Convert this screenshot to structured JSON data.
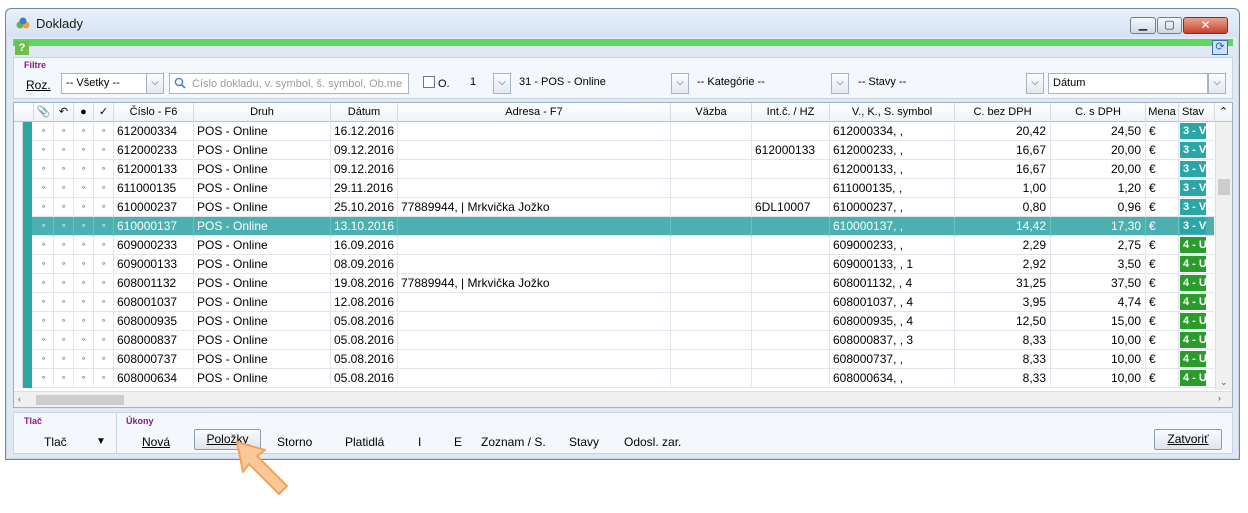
{
  "window": {
    "title": "Doklady",
    "help": "?"
  },
  "filters": {
    "section_label": "Filtre",
    "roz_label": "Roz.",
    "roz_value": "-- Všetky --",
    "search_placeholder": "Číslo dokladu, v. symbol, š. symbol, Ob.menc",
    "o_label": "O.",
    "number_value": "1",
    "type_value": "31 - POS - Online",
    "category_value": "-- Kategórie --",
    "states_value": "-- Stavy --",
    "sort_value": "Dátum"
  },
  "table": {
    "headers": [
      "Číslo - F6",
      "Druh",
      "Dátum",
      "Adresa - F7",
      "Väzba",
      "Int.č. / HZ",
      "V., K., S. symbol",
      "C. bez DPH",
      "C. s DPH",
      "Mena",
      "Stav"
    ],
    "rows": [
      {
        "cislo": "612000334",
        "druh": "POS - Online",
        "datum": "16.12.2016",
        "adresa": "",
        "vazba": "",
        "intc": "",
        "symbol": "612000334, ,",
        "bez": "20,42",
        "sdph": "24,50",
        "mena": "€",
        "stav": "3 - V",
        "stav_color": "#2aa6a6"
      },
      {
        "cislo": "612000233",
        "druh": "POS - Online",
        "datum": "09.12.2016",
        "adresa": "",
        "vazba": "",
        "intc": "612000133",
        "symbol": "612000233, ,",
        "bez": "16,67",
        "sdph": "20,00",
        "mena": "€",
        "stav": "3 - V",
        "stav_color": "#2aa6a6"
      },
      {
        "cislo": "612000133",
        "druh": "POS - Online",
        "datum": "09.12.2016",
        "adresa": "",
        "vazba": "",
        "intc": "",
        "symbol": "612000133, ,",
        "bez": "16,67",
        "sdph": "20,00",
        "mena": "€",
        "stav": "3 - V",
        "stav_color": "#2aa6a6"
      },
      {
        "cislo": "611000135",
        "druh": "POS - Online",
        "datum": "29.11.2016",
        "adresa": "",
        "vazba": "",
        "intc": "",
        "symbol": "611000135, ,",
        "bez": "1,00",
        "sdph": "1,20",
        "mena": "€",
        "stav": "3 - V",
        "stav_color": "#2aa6a6"
      },
      {
        "cislo": "610000237",
        "druh": "POS - Online",
        "datum": "25.10.2016",
        "adresa": "77889944,  | Mrkvička Jožko",
        "vazba": "",
        "intc": "6DL10007",
        "symbol": "610000237, ,",
        "bez": "0,80",
        "sdph": "0,96",
        "mena": "€",
        "stav": "3 - V",
        "stav_color": "#2aa6a6"
      },
      {
        "cislo": "610000137",
        "druh": "POS - Online",
        "datum": "13.10.2016",
        "adresa": "",
        "vazba": "",
        "intc": "",
        "symbol": "610000137, ,",
        "bez": "14,42",
        "sdph": "17,30",
        "mena": "€",
        "stav": "3 - V",
        "stav_color": "#2aa6a6",
        "selected": true
      },
      {
        "cislo": "609000233",
        "druh": "POS - Online",
        "datum": "16.09.2016",
        "adresa": "",
        "vazba": "",
        "intc": "",
        "symbol": "609000233, ,",
        "bez": "2,29",
        "sdph": "2,75",
        "mena": "€",
        "stav": "4 - U",
        "stav_color": "#2b9c2b"
      },
      {
        "cislo": "609000133",
        "druh": "POS - Online",
        "datum": "08.09.2016",
        "adresa": "",
        "vazba": "",
        "intc": "",
        "symbol": "609000133, , 1",
        "bez": "2,92",
        "sdph": "3,50",
        "mena": "€",
        "stav": "4 - U",
        "stav_color": "#2b9c2b"
      },
      {
        "cislo": "608001132",
        "druh": "POS - Online",
        "datum": "19.08.2016",
        "adresa": "77889944,  | Mrkvička Jožko",
        "vazba": "",
        "intc": "",
        "symbol": "608001132, , 4",
        "bez": "31,25",
        "sdph": "37,50",
        "mena": "€",
        "stav": "4 - U",
        "stav_color": "#2b9c2b"
      },
      {
        "cislo": "608001037",
        "druh": "POS - Online",
        "datum": "12.08.2016",
        "adresa": "",
        "vazba": "",
        "intc": "",
        "symbol": "608001037, , 4",
        "bez": "3,95",
        "sdph": "4,74",
        "mena": "€",
        "stav": "4 - U",
        "stav_color": "#2b9c2b"
      },
      {
        "cislo": "608000935",
        "druh": "POS - Online",
        "datum": "05.08.2016",
        "adresa": "",
        "vazba": "",
        "intc": "",
        "symbol": "608000935, , 4",
        "bez": "12,50",
        "sdph": "15,00",
        "mena": "€",
        "stav": "4 - U",
        "stav_color": "#2b9c2b"
      },
      {
        "cislo": "608000837",
        "druh": "POS - Online",
        "datum": "05.08.2016",
        "adresa": "",
        "vazba": "",
        "intc": "",
        "symbol": "608000837, , 3",
        "bez": "8,33",
        "sdph": "10,00",
        "mena": "€",
        "stav": "4 - U",
        "stav_color": "#2b9c2b"
      },
      {
        "cislo": "608000737",
        "druh": "POS - Online",
        "datum": "05.08.2016",
        "adresa": "",
        "vazba": "",
        "intc": "",
        "symbol": "608000737, ,",
        "bez": "8,33",
        "sdph": "10,00",
        "mena": "€",
        "stav": "4 - U",
        "stav_color": "#2b9c2b"
      },
      {
        "cislo": "608000634",
        "druh": "POS - Online",
        "datum": "05.08.2016",
        "adresa": "",
        "vazba": "",
        "intc": "",
        "symbol": "608000634, ,",
        "bez": "8,33",
        "sdph": "10,00",
        "mena": "€",
        "stav": "4 - U",
        "stav_color": "#2b9c2b"
      }
    ]
  },
  "bottom": {
    "tlac_label": "Tlač",
    "tlac_button": "Tlač",
    "ukony_label": "Úkony",
    "actions": {
      "nova": "Nová",
      "polozky": "Položky",
      "storno": "Storno",
      "platidla": "Platidlá",
      "i": "I",
      "e": "E",
      "zoznam": "Zoznam / S.",
      "stavy": "Stavy",
      "odosl": "Odosl. zar."
    },
    "zatvorit": "Zatvoriť"
  }
}
